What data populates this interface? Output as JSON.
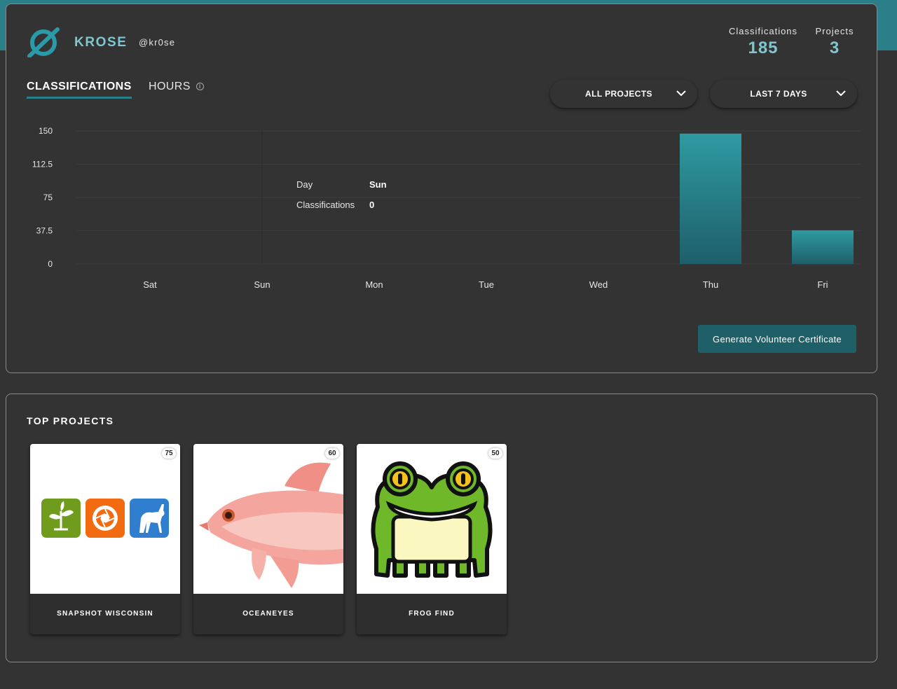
{
  "profile": {
    "username": "KROSE",
    "handle": "@kr0se"
  },
  "stats": {
    "classifications_label": "Classifications",
    "classifications_value": "185",
    "projects_label": "Projects",
    "projects_value": "3"
  },
  "tabs": {
    "classifications": "CLASSIFICATIONS",
    "hours": "HOURS",
    "info_icon": "i"
  },
  "filters": {
    "projects": "ALL PROJECTS",
    "range": "LAST 7 DAYS"
  },
  "tooltip": {
    "day_label": "Day",
    "day_value": "Sun",
    "count_label": "Classifications",
    "count_value": "0"
  },
  "certificate_button": "Generate Volunteer Certificate",
  "top_projects": {
    "title": "TOP PROJECTS",
    "items": [
      {
        "name": "SNAPSHOT WISCONSIN",
        "count": "75"
      },
      {
        "name": "OCEANEYES",
        "count": "60"
      },
      {
        "name": "FROG FIND",
        "count": "50"
      }
    ]
  },
  "colors": {
    "accent": "#2b7f89",
    "accent_light": "#7fc6cf",
    "background": "#333333",
    "button": "#1f5f68"
  },
  "chart_data": {
    "type": "bar",
    "categories": [
      "Sat",
      "Sun",
      "Mon",
      "Tue",
      "Wed",
      "Thu",
      "Fri"
    ],
    "values": [
      0,
      0,
      0,
      0,
      0,
      147,
      38
    ],
    "yticks": [
      "150",
      "112.5",
      "75",
      "37.5",
      "0"
    ],
    "ylim": [
      0,
      150
    ],
    "grid": true,
    "highlighted_category": "Sun"
  }
}
